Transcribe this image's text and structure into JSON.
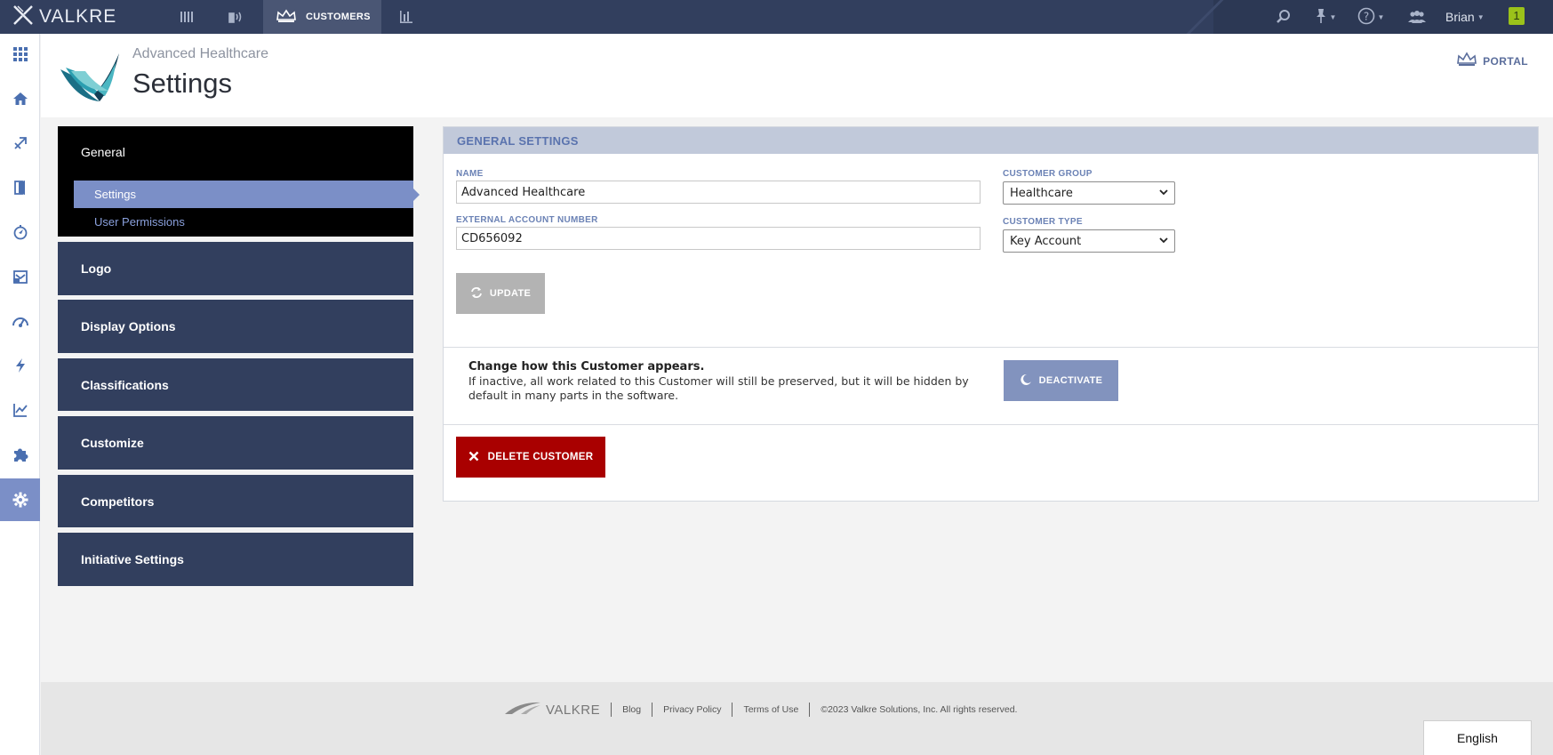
{
  "app": {
    "brand": "VALKRE",
    "nav": {
      "active_tab": "CUSTOMERS",
      "user_name": "Brian",
      "notifications": "1"
    },
    "icons": {
      "nav": [
        "bars-icon",
        "broadcast-icon",
        "crown-icon",
        "chart-icon"
      ],
      "right": [
        "search-icon",
        "pin-icon",
        "help-icon",
        "team-icon"
      ],
      "rail": [
        "apps-grid-icon",
        "home-icon",
        "expand-icon",
        "door-icon",
        "compass-icon",
        "inbox-icon",
        "speed-icon",
        "lightning-icon",
        "analytics-icon",
        "puzzle-icon",
        "gear-icon"
      ]
    }
  },
  "header": {
    "company": "Advanced Healthcare",
    "title": "Settings",
    "portal_label": "PORTAL"
  },
  "menu": {
    "general": "General",
    "sub_items": [
      "Settings",
      "User Permissions"
    ],
    "items": [
      "Logo",
      "Display Options",
      "Classifications",
      "Customize",
      "Competitors",
      "Initiative Settings"
    ]
  },
  "panel": {
    "heading": "GENERAL SETTINGS",
    "name_label": "NAME",
    "name_value": "Advanced Healthcare",
    "ext_label": "EXTERNAL ACCOUNT NUMBER",
    "ext_value": "CD656092",
    "group_label": "CUSTOMER GROUP",
    "group_value": "Healthcare",
    "type_label": "CUSTOMER TYPE",
    "type_value": "Key Account",
    "update_label": "UPDATE",
    "deact_title": "Change how this Customer appears.",
    "deact_text": "If inactive, all work related to this Customer will still be preserved, but it will be hidden by default in many parts in the software.",
    "deactivate_label": "DEACTIVATE",
    "delete_label": "DELETE CUSTOMER"
  },
  "footer": {
    "brand": "VALKRE",
    "links": [
      "Blog",
      "Privacy Policy",
      "Terms of Use"
    ],
    "copyright": "©2023 Valkre Solutions, Inc. All rights reserved.",
    "language": "English"
  },
  "colors": {
    "topbar": "#323f5e",
    "accent": "#7b8fc7",
    "menu_block": "#323f5e",
    "delete": "#a90000"
  }
}
